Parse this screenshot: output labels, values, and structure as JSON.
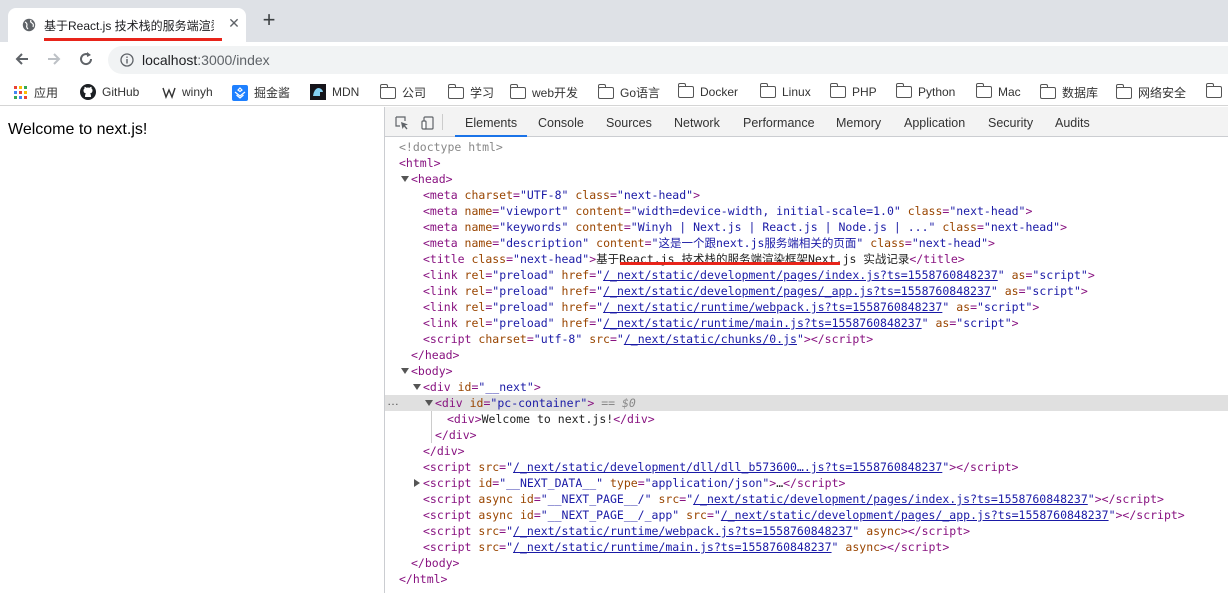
{
  "browser": {
    "tab_title": "基于React.js 技术栈的服务端渲染框架Next.js 实战记录",
    "url_host": "localhost",
    "url_rest": ":3000/index"
  },
  "bookmarks": [
    {
      "label": "应用",
      "icon": "apps-grid-icon"
    },
    {
      "label": "GitHub",
      "icon": "github-icon"
    },
    {
      "label": "winyh",
      "icon": "winyh-icon"
    },
    {
      "label": "掘金酱",
      "icon": "juejin-icon"
    },
    {
      "label": "MDN",
      "icon": "mdn-icon"
    },
    {
      "label": "公司",
      "icon": "folder-icon"
    },
    {
      "label": "学习",
      "icon": "folder-icon"
    },
    {
      "label": "web开发",
      "icon": "folder-icon"
    },
    {
      "label": "Go语言",
      "icon": "folder-icon"
    },
    {
      "label": "Docker",
      "icon": "folder-icon"
    },
    {
      "label": "Linux",
      "icon": "folder-icon"
    },
    {
      "label": "PHP",
      "icon": "folder-icon"
    },
    {
      "label": "Python",
      "icon": "folder-icon"
    },
    {
      "label": "Mac",
      "icon": "folder-icon"
    },
    {
      "label": "数据库",
      "icon": "folder-icon"
    },
    {
      "label": "网络安全",
      "icon": "folder-icon"
    }
  ],
  "page": {
    "welcome": "Welcome to next.js!"
  },
  "devtools": {
    "tabs": [
      "Elements",
      "Console",
      "Sources",
      "Network",
      "Performance",
      "Memory",
      "Application",
      "Security",
      "Audits"
    ],
    "active_tab": "Elements"
  },
  "dom": {
    "doctype": "<!doctype html>",
    "title_text": "基于React.js 技术栈的服务端渲染框架Next.js 实战记录",
    "meta_charset": "\"UTF-8\"",
    "viewport": "\"width=device-width, initial-scale=1.0\"",
    "keywords": "\"Winyh | Next.js | React.js | Node.js | ...\"",
    "description": "\"这是一个跟next.js服务端相关的页面\"",
    "class_next_head": "\"next-head\"",
    "preload_1": "/_next/static/development/pages/index.js?ts=1558760848237",
    "preload_2": "/_next/static/development/pages/_app.js?ts=1558760848237",
    "preload_3": "/_next/static/runtime/webpack.js?ts=1558760848237",
    "preload_4": "/_next/static/runtime/main.js?ts=1558760848237",
    "chunk_0": "/_next/static/chunks/0.js",
    "div_next_id": "\"__next\"",
    "pc_container_id": "\"pc-container\"",
    "dollar0": "== $0",
    "inner_div_text": "Welcome to next.js!",
    "dll_src": "/_next/static/development/dll/dll_b573600….js?ts=1558760848237",
    "next_data_id": "\"__NEXT_DATA__\"",
    "next_data_type": "\"application/json\"",
    "page_index_id": "\"__NEXT_PAGE__/\"",
    "page_app_id": "\"__NEXT_PAGE__/_app\"",
    "body_webpack_src": "/_next/static/runtime/webpack.js?ts=1558760848237",
    "body_main_src": "/_next/static/runtime/main.js?ts=1558760848237"
  }
}
